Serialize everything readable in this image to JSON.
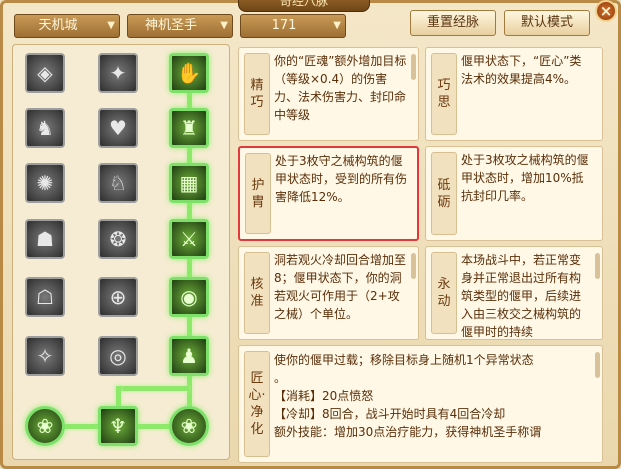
{
  "window": {
    "title": "奇经八脉",
    "close_glyph": "×"
  },
  "dropdowns": [
    {
      "value": "天机城"
    },
    {
      "value": "神机圣手"
    },
    {
      "value": "171"
    }
  ],
  "buttons": {
    "reset": "重置经脉",
    "default_mode": "默认模式"
  },
  "tree": {
    "nodes": [
      {
        "row": 0,
        "col": 0,
        "icon": "gem-emblem-icon",
        "glyph": "◈",
        "active": false
      },
      {
        "row": 0,
        "col": 1,
        "icon": "spirit-flame-icon",
        "glyph": "✦",
        "active": false
      },
      {
        "row": 0,
        "col": 2,
        "icon": "grab-hand-icon",
        "glyph": "✋",
        "active": true
      },
      {
        "row": 1,
        "col": 0,
        "icon": "crouching-figure-icon",
        "glyph": "♞",
        "active": false
      },
      {
        "row": 1,
        "col": 1,
        "icon": "heart-shield-icon",
        "glyph": "♥",
        "active": false
      },
      {
        "row": 1,
        "col": 2,
        "icon": "bell-totem-icon",
        "glyph": "♜",
        "active": true
      },
      {
        "row": 2,
        "col": 0,
        "icon": "sunburst-icon",
        "glyph": "✺",
        "active": false
      },
      {
        "row": 2,
        "col": 1,
        "icon": "rooster-icon",
        "glyph": "♘",
        "active": false
      },
      {
        "row": 2,
        "col": 2,
        "icon": "brick-wall-icon",
        "glyph": "▦",
        "active": true
      },
      {
        "row": 3,
        "col": 0,
        "icon": "ghost-figure-icon",
        "glyph": "☗",
        "active": false
      },
      {
        "row": 3,
        "col": 1,
        "icon": "orb-cluster-icon",
        "glyph": "❂",
        "active": false
      },
      {
        "row": 3,
        "col": 2,
        "icon": "crossed-blades-icon",
        "glyph": "⚔",
        "active": true
      },
      {
        "row": 4,
        "col": 0,
        "icon": "dark-figure-icon",
        "glyph": "☖",
        "active": false
      },
      {
        "row": 4,
        "col": 1,
        "icon": "target-crosshair-icon",
        "glyph": "⊕",
        "active": false
      },
      {
        "row": 4,
        "col": 2,
        "icon": "spinning-orb-icon",
        "glyph": "◉",
        "active": true
      },
      {
        "row": 5,
        "col": 0,
        "icon": "shattered-stone-icon",
        "glyph": "✧",
        "active": false
      },
      {
        "row": 5,
        "col": 1,
        "icon": "vortex-icon",
        "glyph": "◎",
        "active": false
      },
      {
        "row": 5,
        "col": 2,
        "icon": "golem-figure-icon",
        "glyph": "♟",
        "active": true
      },
      {
        "row": 6,
        "col": 0,
        "icon": "swirl-left-icon",
        "glyph": "❀",
        "active": true,
        "round": true
      },
      {
        "row": 6,
        "col": 1,
        "icon": "goblet-icon",
        "glyph": "♆",
        "active": true
      },
      {
        "row": 6,
        "col": 2,
        "icon": "swirl-right-icon",
        "glyph": "❀",
        "active": true,
        "round": true
      }
    ]
  },
  "cards": {
    "jingqiao": {
      "label": "精巧",
      "text": "你的“匠魂”额外增加目标（等级×0.4）的伤害力、法术伤害力、封印命中等级"
    },
    "qiaosi": {
      "label": "巧思",
      "text": "偃甲状态下，“匠心”类法术的效果提高4%。"
    },
    "huqi": {
      "label": "护胄",
      "text": "处于3枚守之械构筑的偃甲状态时，受到的所有伤害降低12%。"
    },
    "dilong": {
      "label": "砥砺",
      "text": "处于3枚攻之械构筑的偃甲状态时，增加10%抵抗封印几率。"
    },
    "hezhun": {
      "label": "核准",
      "text": "洞若观火冷却回合增加至8；偃甲状态下，你的洞若观火可作用于（2+攻之械）个单位。"
    },
    "yongdong": {
      "label": "永动",
      "text": "本场战斗中，若正常变身并正常退出过所有构筑类型的偃甲，后续进入由三枚交之械构筑的偃甲时的持续"
    },
    "jiangxin": {
      "label": "匠心·净化",
      "lines": [
        "使你的偃甲过载；移除目标身上随机1个异常状态",
        "。",
        "【消耗】20点愤怒",
        "【冷却】8回合，战斗开始时具有4回合冷却",
        "额外技能：增加30点治疗能力，获得神机圣手称谓"
      ]
    }
  }
}
